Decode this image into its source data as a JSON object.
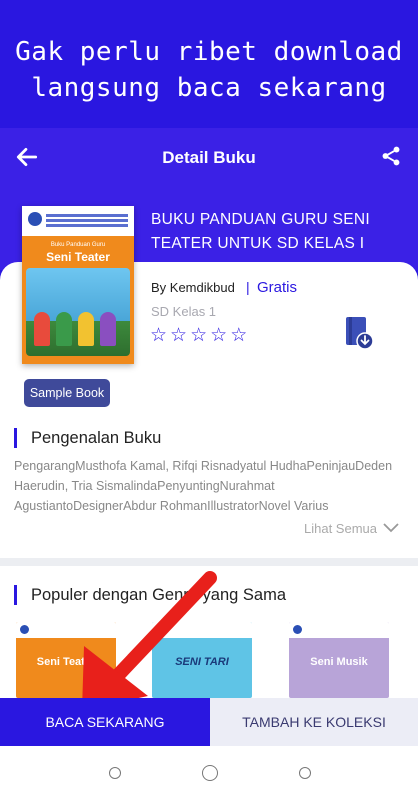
{
  "promo": {
    "line1": "Gak perlu ribet download",
    "line2": "langsung baca sekarang"
  },
  "appbar": {
    "title": "Detail Buku",
    "back_icon": "arrow-left-icon",
    "share_icon": "share-icon"
  },
  "book": {
    "title": "BUKU PANDUAN GURU SENI TEATER UNTUK SD KELAS I",
    "author": "By Kemdikbud",
    "separator": "|",
    "price": "Gratis",
    "level": "SD Kelas 1",
    "rating_max": 5,
    "rating": 0,
    "cover": {
      "subtitle": "Buku Panduan Guru",
      "title": "Seni Teater"
    },
    "download_icon": "book-download-icon"
  },
  "sample_button": "Sample Book",
  "intro": {
    "heading": "Pengenalan Buku",
    "text": "PengarangMusthofa Kamal, Rifqi Risnadyatul HudhaPeninjauDeden Haerudin, Tria SismalindaPenyuntingNurahmat AgustiantoDesignerAbdur RohmanIllustratorNovel Varius",
    "see_all": "Lihat Semua"
  },
  "popular": {
    "heading": "Populer dengan Genre yang Sama",
    "books": [
      {
        "title": "Seni Teater",
        "color": "#f08a1c"
      },
      {
        "title": "SENI TARI",
        "color": "#5fc4e6"
      },
      {
        "title": "Seni Musik",
        "color": "#b8a4d8"
      }
    ]
  },
  "actions": {
    "read": "BACA SEKARANG",
    "add": "TAMBAH KE KOLEKSI"
  },
  "colors": {
    "primary": "#2a17e0",
    "arrow": "#e8201b"
  }
}
